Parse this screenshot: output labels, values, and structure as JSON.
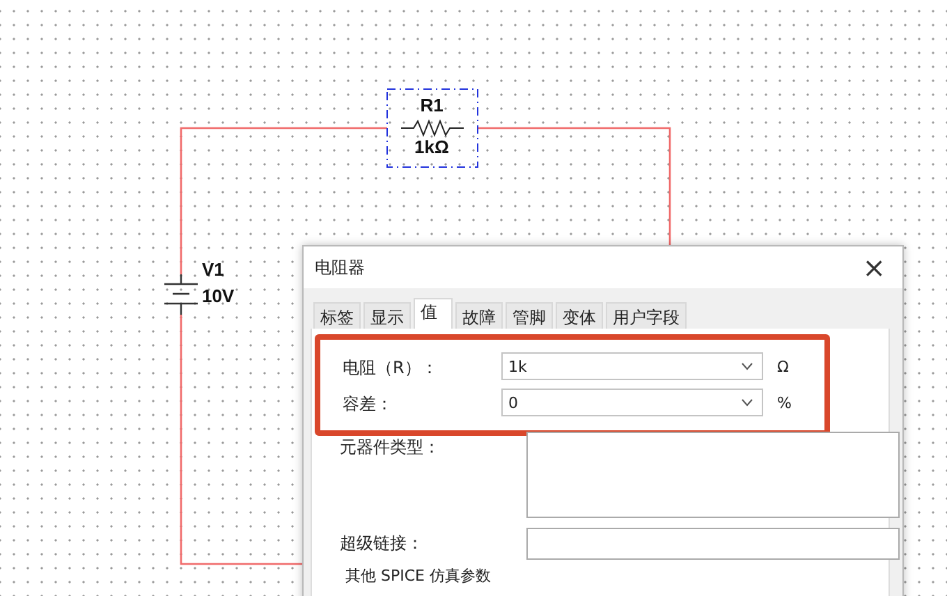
{
  "schematic": {
    "resistor": {
      "name": "R1",
      "value": "1kΩ",
      "selected": true
    },
    "source": {
      "name": "V1",
      "value": "10V"
    }
  },
  "dialog": {
    "title": "电阻器",
    "close": "×",
    "tabs": [
      {
        "label": "标签",
        "selected": false
      },
      {
        "label": "显示",
        "selected": false
      },
      {
        "label": "值",
        "selected": true
      },
      {
        "label": "故障",
        "selected": false
      },
      {
        "label": "管脚",
        "selected": false
      },
      {
        "label": "变体",
        "selected": false
      },
      {
        "label": "用户字段",
        "selected": false
      }
    ],
    "highlighted_fields": [
      {
        "kind": "combo",
        "label": "电阻（R）：",
        "value": "1k",
        "unit": "Ω"
      },
      {
        "kind": "combo",
        "label": "容差：",
        "value": "0",
        "unit": "%"
      }
    ],
    "fields": [
      {
        "kind": "textarea",
        "label": "元器件类型："
      },
      {
        "kind": "text",
        "label": "超级链接："
      }
    ],
    "group_title": "其他 SPICE 仿真参数"
  }
}
